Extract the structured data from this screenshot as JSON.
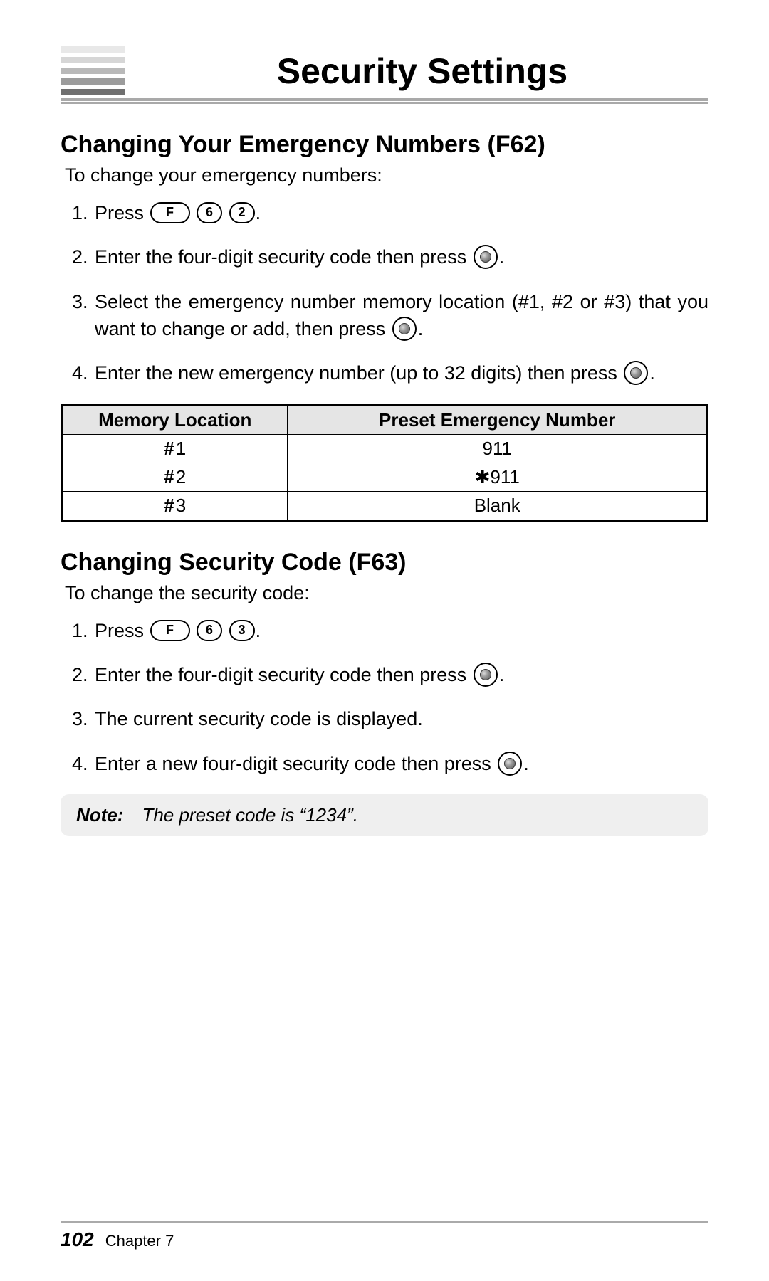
{
  "header": {
    "title": "Security Settings"
  },
  "section1": {
    "heading": "Changing Your Emergency Numbers (F62)",
    "intro": "To change your emergency numbers:",
    "steps": {
      "s1_prefix": "Press ",
      "s1_keys": [
        "F",
        "6",
        "2"
      ],
      "s2_a": "Enter the four-digit security code then press ",
      "s3_a": "Select the emergency number memory location (#1, #2 or #3) that you want to change or add, then press ",
      "s4_a": "Enter the new emergency number (up to 32 digits) then press "
    },
    "table": {
      "headers": [
        "Memory Location",
        "Preset Emergency Number"
      ],
      "rows": [
        {
          "loc": "1",
          "num": "911"
        },
        {
          "loc": "2",
          "num": "✱911"
        },
        {
          "loc": "3",
          "num": "Blank"
        }
      ]
    }
  },
  "section2": {
    "heading": "Changing Security Code (F63)",
    "intro": "To change the security code:",
    "steps": {
      "s1_prefix": "Press ",
      "s1_keys": [
        "F",
        "6",
        "3"
      ],
      "s2_a": "Enter the four-digit security code then press ",
      "s3": "The current security code is displayed.",
      "s4_a": "Enter a new four-digit security code then press "
    },
    "note": {
      "label": "Note:",
      "text": "The preset code is “1234”."
    }
  },
  "footer": {
    "page": "102",
    "chapter": "Chapter 7"
  },
  "punct": {
    "period": "."
  },
  "hash": "#"
}
